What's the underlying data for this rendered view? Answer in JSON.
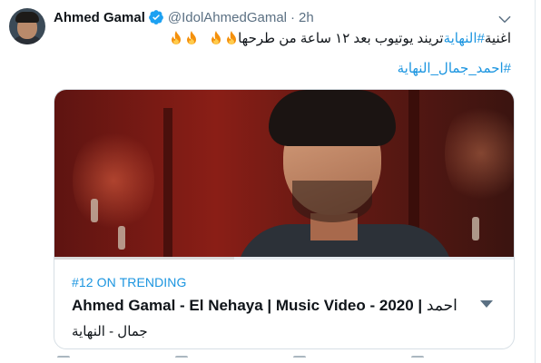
{
  "tweet": {
    "author_name": "Ahmed Gamal",
    "handle": "@IdolAhmedGamal",
    "dot": "·",
    "time": "2h",
    "text_line1_start": "اغنية ",
    "text_line1_hashtag": "#النهاية",
    "text_line1_end": " تريند يوتيوب بعد ١٢ ساعة من طرحها",
    "text_line2_hashtag": "#احمد_جمال_النهاية",
    "verified": true
  },
  "card": {
    "trending_label": "#12 ON TRENDING",
    "title_en": "Ahmed Gamal - El Nehaya | Music Video - 2020 | ",
    "title_ar": "احمد",
    "subtitle": "جمال - النهاية",
    "progress_fraction": 0.39
  },
  "icons": {
    "verified": "verified-badge-icon",
    "caret": "chevron-down-icon",
    "fire": "fire-emoji-icon",
    "dropdown": "dropdown-triangle-icon"
  },
  "colors": {
    "accent": "#1b95e0",
    "text": "#0f1419",
    "muted": "#5b7083",
    "border": "#d7dfe5"
  }
}
